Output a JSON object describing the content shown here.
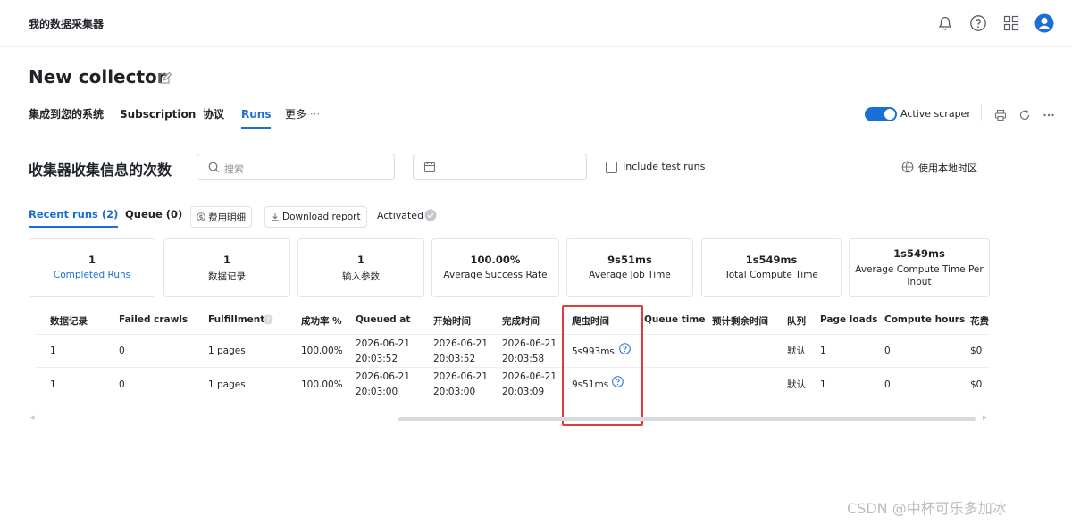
{
  "app": {
    "name": "我的数据采集器"
  },
  "page": {
    "title": "New collector"
  },
  "tabs": [
    {
      "label": "集成到您的系统"
    },
    {
      "label": "Subscription"
    },
    {
      "label": "协议"
    },
    {
      "label": "Runs"
    },
    {
      "label": "更多"
    }
  ],
  "tabs_more_glyph": "···",
  "toggle": {
    "label": "Active scraper",
    "on": true
  },
  "section": {
    "title": "收集器收集信息的次数"
  },
  "search": {
    "placeholder": "搜索"
  },
  "include_test": {
    "label": "Include test runs",
    "checked": false
  },
  "timezone": {
    "label": "使用本地时区"
  },
  "subtabs": {
    "recent": "Recent runs (2)",
    "queue": "Queue (0)"
  },
  "buttons": {
    "cost": "费用明细",
    "download": "Download report"
  },
  "activated": {
    "label": "Activated"
  },
  "stats": [
    {
      "value": "1",
      "label": "Completed Runs"
    },
    {
      "value": "1",
      "label": "数据记录"
    },
    {
      "value": "1",
      "label": "输入参数"
    },
    {
      "value": "100.00%",
      "label": "Average Success Rate"
    },
    {
      "value": "9s51ms",
      "label": "Average Job Time"
    },
    {
      "value": "1s549ms",
      "label": "Total Compute Time"
    },
    {
      "value": "1s549ms",
      "label": "Average Compute Time Per Input"
    }
  ],
  "table": {
    "headers": [
      "数据记录",
      "Failed crawls",
      "Fulfillment",
      "成功率 %",
      "Queued at",
      "开始时间",
      "完成时间",
      "爬虫时间",
      "Queue time",
      "预计剩余时间",
      "队列",
      "Page loads",
      "Compute hours",
      "花费"
    ],
    "rows": [
      {
        "records": "1",
        "failed": "0",
        "fulfillment": "1 pages",
        "success": "100.00%",
        "queued_date": "2026-06-21",
        "queued_time": "20:03:52",
        "start_date": "2026-06-21",
        "start_time": "20:03:52",
        "end_date": "2026-06-21",
        "end_time": "20:03:58",
        "crawl": "5s993ms",
        "queue_time": "",
        "remaining": "",
        "queue": "默认",
        "pages": "1",
        "compute": "0",
        "cost": "$0"
      },
      {
        "records": "1",
        "failed": "0",
        "fulfillment": "1 pages",
        "success": "100.00%",
        "queued_date": "2026-06-21",
        "queued_time": "20:03:00",
        "start_date": "2026-06-21",
        "start_time": "20:03:00",
        "end_date": "2026-06-21",
        "end_time": "20:03:09",
        "crawl": "9s51ms",
        "queue_time": "",
        "remaining": "",
        "queue": "默认",
        "pages": "1",
        "compute": "0",
        "cost": "$0"
      }
    ]
  },
  "watermark": "CSDN @中杯可乐多加冰",
  "colors": {
    "accent": "#1a6fd6",
    "highlight": "#e03a3a",
    "border": "#e1e4e8"
  },
  "icons": [
    "bell-icon",
    "help-icon",
    "apps-grid-icon",
    "user-avatar-icon",
    "edit-icon",
    "search-icon",
    "calendar-icon",
    "timezone-icon",
    "check-circle-icon",
    "question-icon",
    "printer-icon",
    "refresh-icon",
    "more-icon"
  ]
}
